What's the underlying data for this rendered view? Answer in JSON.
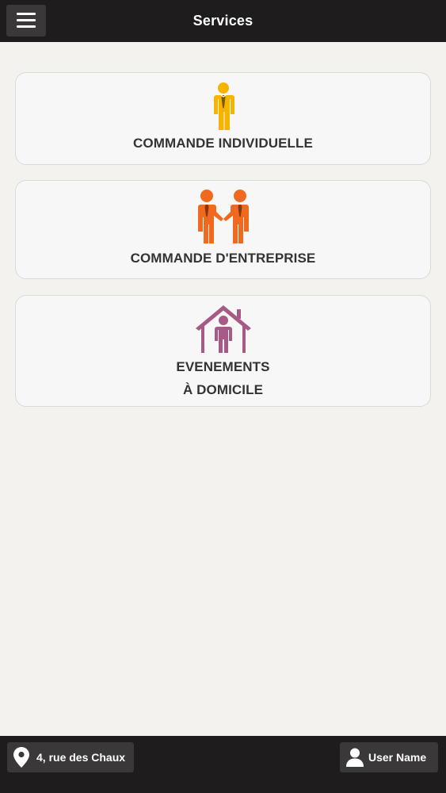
{
  "header": {
    "title": "Services",
    "menu_icon": "hamburger-menu-icon"
  },
  "services": [
    {
      "label": "COMMANDE INDIVIDUELLE",
      "icon": "businessman-icon",
      "color": "#f4b400"
    },
    {
      "label": "COMMANDE D'ENTREPRISE",
      "icon": "handshake-icon",
      "color": "#ef6a1f"
    },
    {
      "label_line1": "EVENEMENTS",
      "label_line2": "À DOMICILE",
      "icon": "home-person-icon",
      "color": "#a85a86"
    }
  ],
  "footer": {
    "address": "4, rue des Chaux",
    "address_icon": "location-pin-icon",
    "user": "User Name",
    "user_icon": "user-icon"
  },
  "colors": {
    "bar_bg": "#1e1c1d",
    "button_bg": "#3a3839",
    "page_bg": "#f3f2ef",
    "card_bg": "#f8f7f8"
  }
}
